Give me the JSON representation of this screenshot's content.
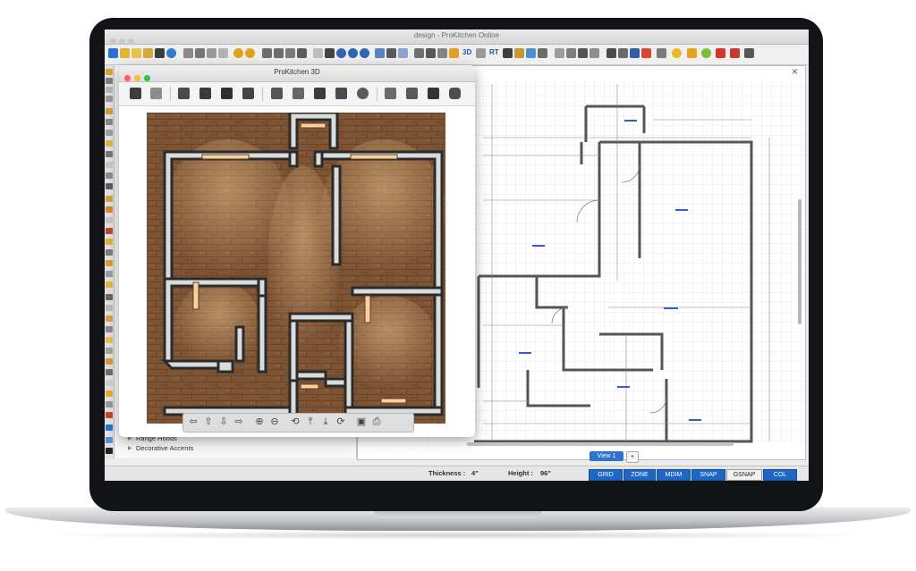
{
  "app": {
    "title": "design - ProKitchen Online",
    "toolbar_icons": [
      "new-icon",
      "open-folder-icon",
      "folder-icon",
      "folder-save-icon",
      "save-icon",
      "settings-icon",
      "copy-icon",
      "cut-icon",
      "paste-icon",
      "delete-icon",
      "undo-icon",
      "redo-icon",
      "print-icon",
      "print-preview-icon",
      "print-setup-icon",
      "export-icon",
      "select-icon",
      "move-icon",
      "zoom-in-icon",
      "zoom-out-icon",
      "zoom-fit-icon",
      "person-icon",
      "walk-icon",
      "layers-icon",
      "grid-icon",
      "elevation-icon",
      "list-icon",
      "catalog-icon",
      "house-icon",
      "render-icon",
      "wall-icon",
      "cabinet-icon",
      "appliance-icon",
      "door-icon",
      "window-icon",
      "light-icon",
      "bulb-icon",
      "warning-icon",
      "help-icon",
      "flag-icon",
      "globe-icon",
      "info-icon",
      "monitor-icon",
      "pin-icon"
    ],
    "toolbar_text_buttons": [
      "3D",
      "RT"
    ],
    "close_label": "×"
  },
  "catalog": {
    "items": [
      "Range Hoods",
      "Decorative Accents"
    ]
  },
  "view_tabs": {
    "active": "View 1",
    "add": "+"
  },
  "status": {
    "thickness_label": "Thickness :",
    "thickness_value": "4\"",
    "height_label": "Height :",
    "height_value": "96\"",
    "buttons": [
      {
        "label": "GRID",
        "active": true
      },
      {
        "label": "ZONE",
        "active": true
      },
      {
        "label": "MDIM",
        "active": true
      },
      {
        "label": "SNAP",
        "active": true
      },
      {
        "label": "GSNAP",
        "active": false
      },
      {
        "label": "COL",
        "active": true
      }
    ]
  },
  "window3d": {
    "title": "ProKitchen 3D",
    "toolbar_icons": [
      "save-icon",
      "print-icon",
      "move-icon",
      "cube-front-icon",
      "cube-side-icon",
      "cube-top-icon",
      "wall-view-icon",
      "door-view-icon",
      "cabinet-view-icon",
      "lamp-icon",
      "sun-icon",
      "room-icon",
      "garage-icon",
      "check-icon",
      "cylinder-icon"
    ],
    "nav_icons": [
      "arrow-left-icon",
      "arrow-up-icon",
      "arrow-down-icon",
      "arrow-right-icon",
      "zoom-in-icon",
      "zoom-out-icon",
      "rotate-left-icon",
      "rotate-up-icon",
      "rotate-down-icon",
      "rotate-right-icon",
      "screen-icon",
      "camera-icon"
    ]
  },
  "colors": {
    "accent_blue": "#1f67c6",
    "floor_wood": "#7a5232",
    "wall_gray": "#dadcdc",
    "wall_outline": "#2b2b2b",
    "plan_line": "#555555",
    "grid_line": "#d8d8d8"
  }
}
